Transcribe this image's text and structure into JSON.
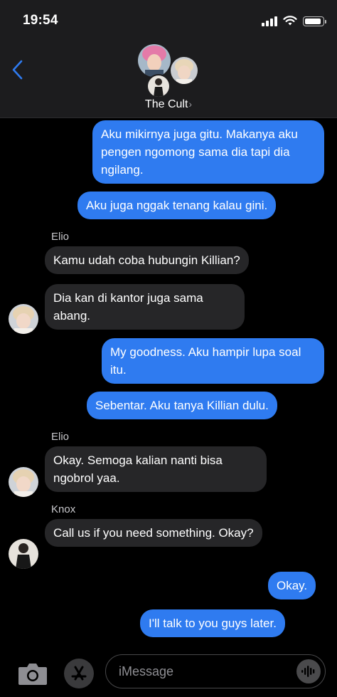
{
  "status_bar": {
    "time": "19:54",
    "battery_level": 0.95
  },
  "header": {
    "group_name": "The Cult"
  },
  "messages": [
    {
      "type": "outgoing",
      "text": "Aku mikirnya juga gitu. Makanya aku pengen ngomong sama dia tapi dia ngilang."
    },
    {
      "type": "outgoing",
      "text": "Aku juga nggak tenang kalau gini."
    },
    {
      "type": "sender",
      "text": "Elio"
    },
    {
      "type": "incoming",
      "text": "Kamu udah coba hubungin Killian?"
    },
    {
      "type": "incoming",
      "text": "Dia kan di kantor juga sama abang."
    },
    {
      "type": "outgoing",
      "text": "My goodness. Aku hampir lupa soal itu."
    },
    {
      "type": "outgoing",
      "text": "Sebentar. Aku tanya Killian dulu."
    },
    {
      "type": "sender",
      "text": "Elio"
    },
    {
      "type": "incoming",
      "text": "Okay. Semoga kalian nanti bisa ngobrol yaa."
    },
    {
      "type": "sender",
      "text": "Knox"
    },
    {
      "type": "incoming",
      "text": "Call us if you need something. Okay?"
    },
    {
      "type": "outgoing",
      "text": "Okay."
    },
    {
      "type": "outgoing",
      "text": "I'll talk to you guys later."
    }
  ],
  "input": {
    "placeholder": "iMessage"
  },
  "icons": {
    "back": "chevron-left-icon",
    "camera": "camera-icon",
    "apps": "app-store-icon",
    "audio": "audio-waveform-icon"
  },
  "colors": {
    "outgoing": "#2f7bf0",
    "incoming": "#262628",
    "accent": "#2f7bf0"
  }
}
